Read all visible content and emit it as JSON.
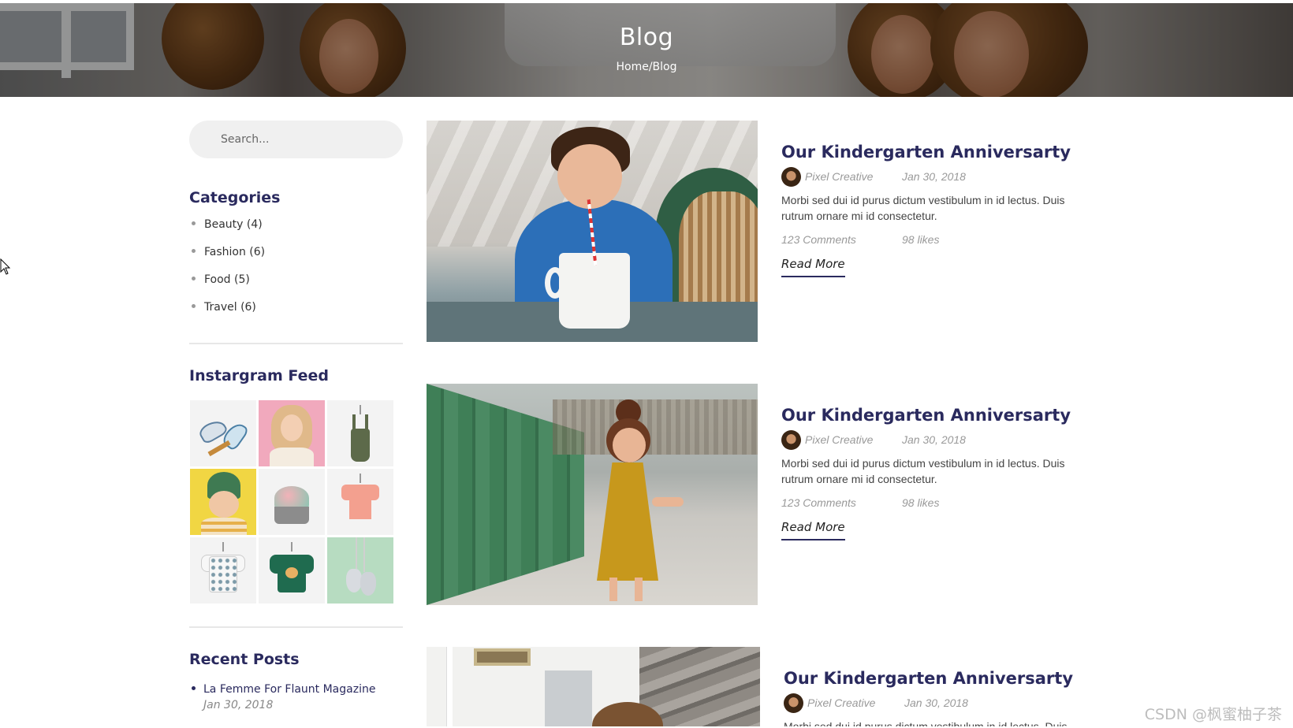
{
  "banner": {
    "title": "Blog",
    "breadcrumb": "Home/Blog"
  },
  "sidebar": {
    "search_placeholder": "Search...",
    "categories_heading": "Categories",
    "categories": [
      {
        "label": "Beauty (4)"
      },
      {
        "label": "Fashion (6)"
      },
      {
        "label": "Food (5)"
      },
      {
        "label": "Travel (6)"
      }
    ],
    "instagram_heading": "Instargram Feed",
    "instagram_items": [
      "sneakers",
      "girl-portrait-pink",
      "green-overalls",
      "girl-green-beanie",
      "knit-hat",
      "pink-tshirt",
      "printed-sweater",
      "green-sweatshirt",
      "baby-shoes-mint"
    ],
    "recent_heading": "Recent Posts",
    "recent_posts": [
      {
        "title": "La Femme For Flaunt Magazine",
        "date": "Jan 30, 2018"
      }
    ]
  },
  "posts": [
    {
      "title": "Our Kindergarten Anniversarty",
      "author": "Pixel Creative",
      "date": "Jan 30, 2018",
      "excerpt": "Morbi sed dui id purus dictum vestibulum in id lectus. Duis rutrum ornare mi id consectetur.",
      "comments": "123 Comments",
      "likes": "98 likes",
      "read_more": "Read More",
      "image": "boy-drinking-from-mug"
    },
    {
      "title": "Our Kindergarten Anniversarty",
      "author": "Pixel Creative",
      "date": "Jan 30, 2018",
      "excerpt": "Morbi sed dui id purus dictum vestibulum in id lectus. Duis rutrum ornare mi id consectetur.",
      "comments": "123 Comments",
      "likes": "98 likes",
      "read_more": "Read More",
      "image": "girl-in-yellow-dress"
    },
    {
      "title": "Our Kindergarten Anniversarty",
      "author": "Pixel Creative",
      "date": "Jan 30, 2018",
      "excerpt": "Morbi sed dui id purus dictum vestibulum in id lectus. Duis",
      "image": "kid-by-window"
    }
  ],
  "watermark": "CSDN @枫蜜柚子茶",
  "colors": {
    "heading": "#2a2a5e",
    "meta": "#999999",
    "search_bg": "#f0f0f0"
  }
}
